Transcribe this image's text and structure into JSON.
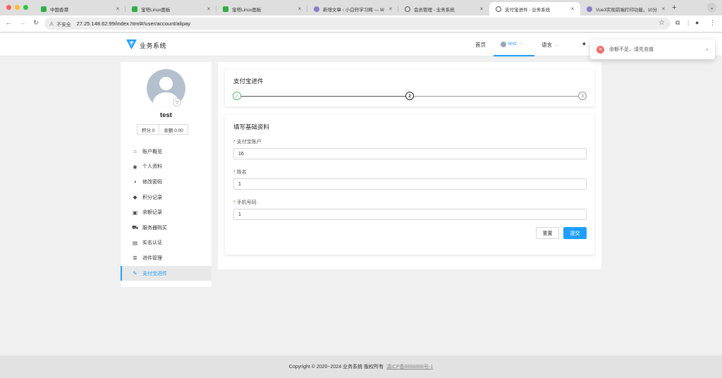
{
  "browser": {
    "window_controls": {
      "close_color": "#ff5f57",
      "minimize_color": "#febc2e",
      "maximize_color": "#28c840"
    },
    "tabs": [
      {
        "title": "中国香港",
        "favicon": "green-shield-icon",
        "active": false
      },
      {
        "title": "宝塔Linux面板",
        "favicon": "green-shield-icon",
        "active": false
      },
      {
        "title": "宝塔Linux面板",
        "favicon": "green-shield-icon",
        "active": false
      },
      {
        "title": "新增文章 ‹ 小白轩学习网 — Wo",
        "favicon": "purple-feather-icon",
        "active": false
      },
      {
        "title": "会员管理 - 业务系统",
        "favicon": "globe-icon",
        "active": false
      },
      {
        "title": "支付宝进件 - 业务系统",
        "favicon": "globe-icon",
        "active": true
      },
      {
        "title": "Vue3实现前端打印功能，10分",
        "favicon": "purple-feather-icon",
        "active": false
      }
    ],
    "close_glyph": "×",
    "new_tab_glyph": "+",
    "tab_menu_glyph": "⌄",
    "address": {
      "security_label": "不安全",
      "url": "27.25.148.62:99/index.html#/user/account/alipay"
    }
  },
  "header": {
    "brand": "业务系统",
    "nav": {
      "home": "首页",
      "user": "test",
      "language": "语言"
    },
    "accent_color": "#1e9fff"
  },
  "sidebar": {
    "username": "test",
    "points_label": "积分 0",
    "balance_label": "余额 0.00",
    "items": [
      {
        "label": "账户概览",
        "icon": "home-icon"
      },
      {
        "label": "个人资料",
        "icon": "user-circle-icon"
      },
      {
        "label": "修改密码",
        "icon": "shield-icon"
      },
      {
        "label": "积分记录",
        "icon": "tag-icon"
      },
      {
        "label": "余额记录",
        "icon": "money-icon"
      },
      {
        "label": "服务器购买",
        "icon": "cart-icon"
      },
      {
        "label": "实名认证",
        "icon": "id-card-icon"
      },
      {
        "label": "进件管理",
        "icon": "list-icon"
      },
      {
        "label": "支付宝进件",
        "icon": "edit-icon",
        "active": true
      }
    ]
  },
  "steps_card": {
    "title": "支付宝进件",
    "steps": [
      {
        "label": "✓",
        "state": "done"
      },
      {
        "label": "2",
        "state": "current"
      },
      {
        "label": "3",
        "state": "todo"
      }
    ]
  },
  "form": {
    "title": "填写基础资料",
    "fields": [
      {
        "label": "支付宝账户",
        "value": "16"
      },
      {
        "label": "姓名",
        "value": "1"
      },
      {
        "label": "手机号码",
        "value": "1"
      }
    ],
    "required_mark": "*",
    "reset_label": "重置",
    "submit_label": "提交"
  },
  "toast": {
    "message": "余额不足，请先充值",
    "type": "error",
    "color": "#f56c6c"
  },
  "footer": {
    "copyright": "Copyright © 2020~2024 业务系统 版权所有",
    "icp": "滇ICP备8888888号-1"
  }
}
